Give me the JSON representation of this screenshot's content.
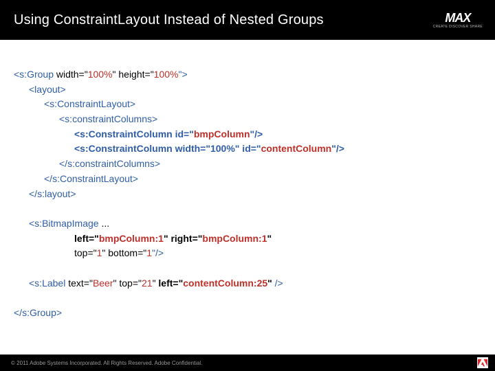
{
  "header": {
    "title": "Using ConstraintLayout Instead of Nested Groups",
    "logo_main": "MAX",
    "logo_sub": "CREATE DISCOVER SHARE"
  },
  "code": {
    "l1a": "<s:Group",
    "l1b": " width=\"",
    "l1c": "100%",
    "l1d": "\" height=\"",
    "l1e": "100%",
    "l1f": "\">",
    "l2": "<layout>",
    "l3": "<s:ConstraintLayout>",
    "l4": "<s:constraintColumns>",
    "l5a": "<s:ConstraintColumn id=\"",
    "l5b": "bmpColumn",
    "l5c": "\"/>",
    "l6a": "<s:ConstraintColumn width=\"100%\" id=\"",
    "l6b": "contentColumn",
    "l6c": "\"/>",
    "l7": "</s:constraintColumns>",
    "l8": "</s:ConstraintLayout>",
    "l9": "</s:layout>",
    "l10a": "<s:BitmapImage",
    "l10b": " ...",
    "l11a": "left=\"",
    "l11b": "bmpColumn:1",
    "l11c": "\" right=\"",
    "l11d": "bmpColumn:1",
    "l11e": "\"",
    "l12a": "top=\"",
    "l12b": "1",
    "l12c": "\" bottom=\"",
    "l12d": "1",
    "l12e": "\"/>",
    "l13a": "<s:Label",
    "l13b": " text=\"",
    "l13c": "Beer",
    "l13d": "\" top=\"",
    "l13e": "21",
    "l13f": "\" ",
    "l13g": "left=\"",
    "l13h": "contentColumn:25",
    "l13i": "\"",
    "l13j": " />",
    "l14": "</s:Group>"
  },
  "footer": {
    "copyright": "© 2011 Adobe Systems Incorporated. All Rights Reserved. Adobe Confidential."
  }
}
